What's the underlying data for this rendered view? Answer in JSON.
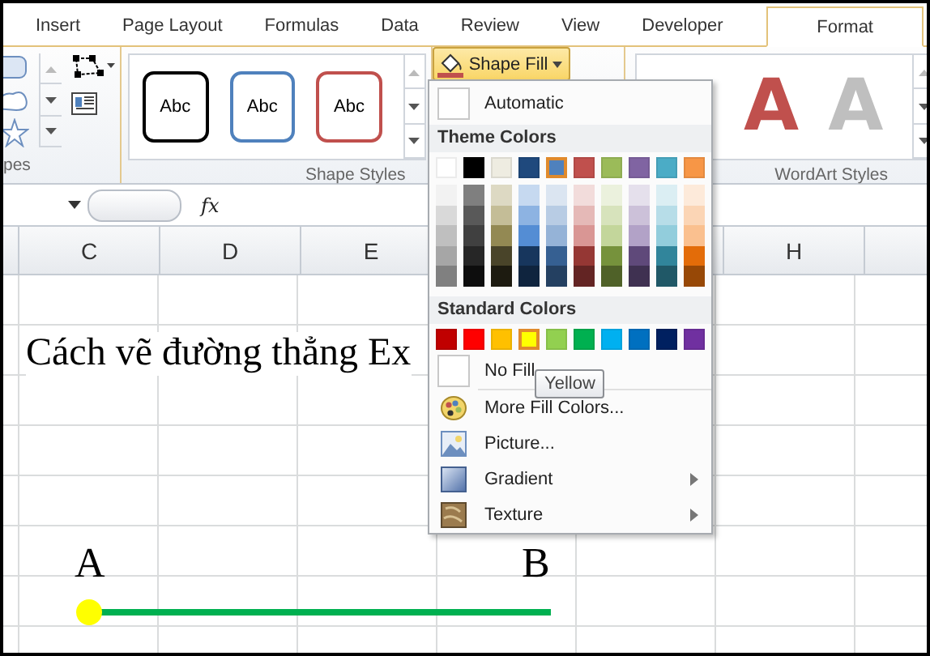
{
  "tabs": [
    {
      "label": "Insert",
      "selected": false
    },
    {
      "label": "Page Layout",
      "selected": false
    },
    {
      "label": "Formulas",
      "selected": false
    },
    {
      "label": "Data",
      "selected": false
    },
    {
      "label": "Review",
      "selected": false
    },
    {
      "label": "View",
      "selected": false
    },
    {
      "label": "Developer",
      "selected": false
    },
    {
      "label": "Format",
      "selected": true
    }
  ],
  "ribbon": {
    "groups": [
      {
        "kind": "shapes",
        "label": "pes"
      },
      {
        "kind": "shape_styles",
        "label": "Shape Styles",
        "styles": [
          {
            "label": "Abc",
            "color": "#000000"
          },
          {
            "label": "Abc",
            "color": "#4f81bd"
          },
          {
            "label": "Abc",
            "color": "#c0504d"
          }
        ]
      },
      {
        "kind": "fill",
        "button": {
          "label": "Shape Fill",
          "pressed": true
        }
      },
      {
        "kind": "wordart",
        "label": "WordArt Styles",
        "letters": [
          {
            "label": "A",
            "color": "#c0504d"
          },
          {
            "label": "A",
            "color": "#bfbfbf"
          }
        ]
      }
    ]
  },
  "formula_bar": {
    "fx": "fx"
  },
  "sheet": {
    "column_headers": [
      "C",
      "D",
      "E",
      "H"
    ],
    "title": "Cách vẽ đường thẳng Ex",
    "points": [
      {
        "label": "A"
      },
      {
        "label": "B"
      }
    ]
  },
  "shape_fill_menu": {
    "top_items": [
      {
        "kind": "swatch",
        "label": "Automatic"
      }
    ],
    "theme_header": "Theme Colors",
    "theme_colors": [
      {
        "color": "#ffffff",
        "selected": false,
        "shades": [
          {
            "color": "#f2f2f2"
          },
          {
            "color": "#d9d9d9"
          },
          {
            "color": "#bfbfbf"
          },
          {
            "color": "#a6a6a6"
          },
          {
            "color": "#808080"
          }
        ]
      },
      {
        "color": "#000000",
        "selected": false,
        "shades": [
          {
            "color": "#7f7f7f"
          },
          {
            "color": "#595959"
          },
          {
            "color": "#404040"
          },
          {
            "color": "#262626"
          },
          {
            "color": "#0d0d0d"
          }
        ]
      },
      {
        "color": "#eeece1",
        "selected": false,
        "shades": [
          {
            "color": "#ddd9c3"
          },
          {
            "color": "#c4bd97"
          },
          {
            "color": "#938953"
          },
          {
            "color": "#494429"
          },
          {
            "color": "#1d1b10"
          }
        ]
      },
      {
        "color": "#1f497d",
        "selected": false,
        "shades": [
          {
            "color": "#c6d9f0"
          },
          {
            "color": "#8db3e2"
          },
          {
            "color": "#548dd4"
          },
          {
            "color": "#17365d"
          },
          {
            "color": "#0f243e"
          }
        ]
      },
      {
        "color": "#4f81bd",
        "selected": true,
        "shades": [
          {
            "color": "#dbe5f1"
          },
          {
            "color": "#b8cce4"
          },
          {
            "color": "#95b3d7"
          },
          {
            "color": "#366092"
          },
          {
            "color": "#244061"
          }
        ]
      },
      {
        "color": "#c0504d",
        "selected": false,
        "shades": [
          {
            "color": "#f2dcdb"
          },
          {
            "color": "#e5b9b7"
          },
          {
            "color": "#d99694"
          },
          {
            "color": "#953734"
          },
          {
            "color": "#632423"
          }
        ]
      },
      {
        "color": "#9bbb59",
        "selected": false,
        "shades": [
          {
            "color": "#ebf1dd"
          },
          {
            "color": "#d7e3bc"
          },
          {
            "color": "#c3d69b"
          },
          {
            "color": "#76923c"
          },
          {
            "color": "#4f6128"
          }
        ]
      },
      {
        "color": "#8064a2",
        "selected": false,
        "shades": [
          {
            "color": "#e5e0ec"
          },
          {
            "color": "#ccc1d9"
          },
          {
            "color": "#b2a2c7"
          },
          {
            "color": "#5f497a"
          },
          {
            "color": "#3f3151"
          }
        ]
      },
      {
        "color": "#4bacc6",
        "selected": false,
        "shades": [
          {
            "color": "#dbeef3"
          },
          {
            "color": "#b7dde8"
          },
          {
            "color": "#92cddc"
          },
          {
            "color": "#31859b"
          },
          {
            "color": "#205867"
          }
        ]
      },
      {
        "color": "#f79646",
        "selected": false,
        "shades": [
          {
            "color": "#fdeada"
          },
          {
            "color": "#fbd5b5"
          },
          {
            "color": "#fac08f"
          },
          {
            "color": "#e36c09"
          },
          {
            "color": "#974806"
          }
        ]
      }
    ],
    "standard_header": "Standard Colors",
    "standard_colors": [
      {
        "color": "#c00000",
        "selected": false
      },
      {
        "color": "#ff0000",
        "selected": false
      },
      {
        "color": "#ffc000",
        "selected": false
      },
      {
        "color": "#ffff00",
        "selected": true
      },
      {
        "color": "#92d050",
        "selected": false
      },
      {
        "color": "#00b050",
        "selected": false
      },
      {
        "color": "#00b0f0",
        "selected": false
      },
      {
        "color": "#0070c0",
        "selected": false
      },
      {
        "color": "#002060",
        "selected": false
      },
      {
        "color": "#7030a0",
        "selected": false
      }
    ],
    "items": [
      {
        "kind": "swatch",
        "label": "No Fill",
        "submenu": false
      },
      {
        "kind": "palette",
        "label": "More Fill Colors...",
        "submenu": false
      },
      {
        "kind": "picture",
        "label": "Picture...",
        "submenu": false
      },
      {
        "kind": "gradient",
        "label": "Gradient",
        "submenu": true
      },
      {
        "kind": "texture",
        "label": "Texture",
        "submenu": true
      }
    ],
    "tooltip": "Yellow"
  }
}
